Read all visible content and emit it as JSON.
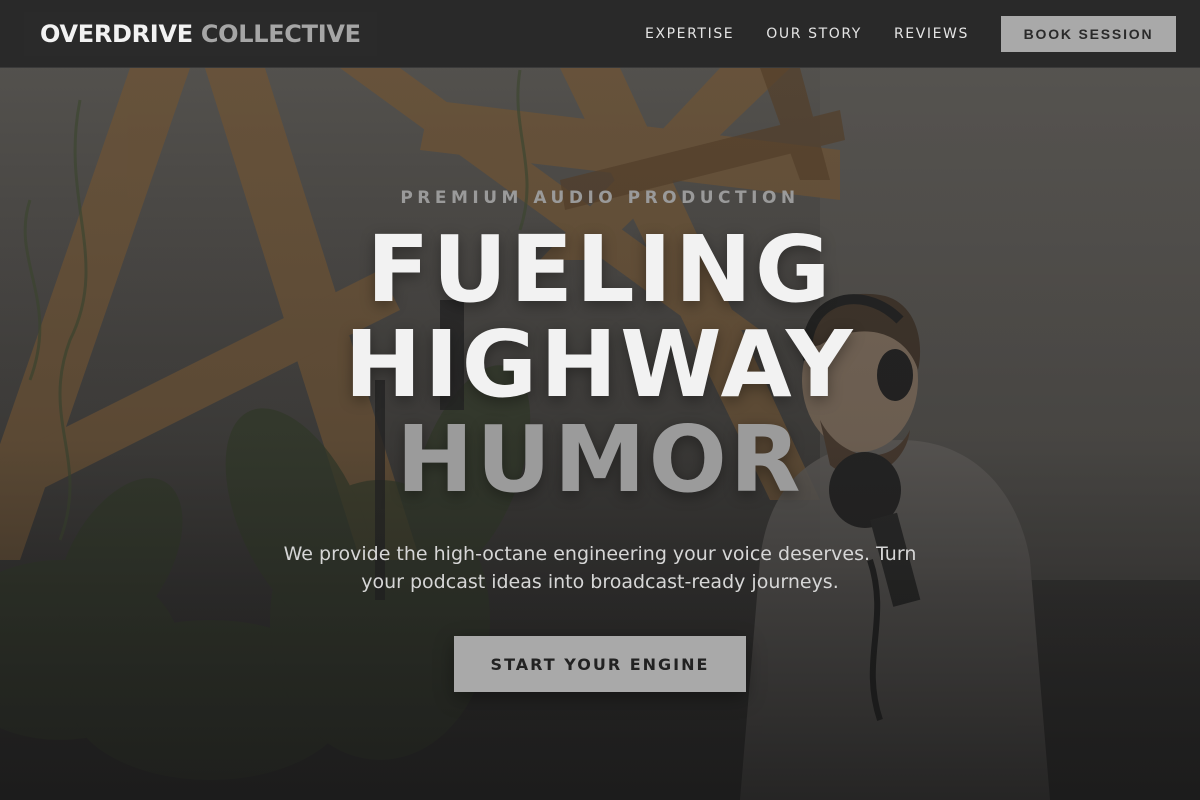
{
  "header": {
    "logo_primary": "OVERDRIVE",
    "logo_secondary": "COLLECTIVE",
    "nav": [
      {
        "label": "EXPERTISE"
      },
      {
        "label": "OUR STORY"
      },
      {
        "label": "REVIEWS"
      }
    ],
    "cta_label": "BOOK SESSION"
  },
  "hero": {
    "eyebrow": "PREMIUM AUDIO PRODUCTION",
    "headline": [
      "FUELING",
      "HIGHWAY",
      "HUMOR"
    ],
    "subtitle": "We provide the high-octane engineering your voice deserves. Turn your podcast ideas into broadcast-ready journeys.",
    "cta_label": "START YOUR ENGINE"
  },
  "colors": {
    "header_bg": "#282828",
    "accent_gray": "#a9a9a9",
    "headline_white": "#f2f2f2",
    "headline_accent": "#9b9b9b"
  }
}
